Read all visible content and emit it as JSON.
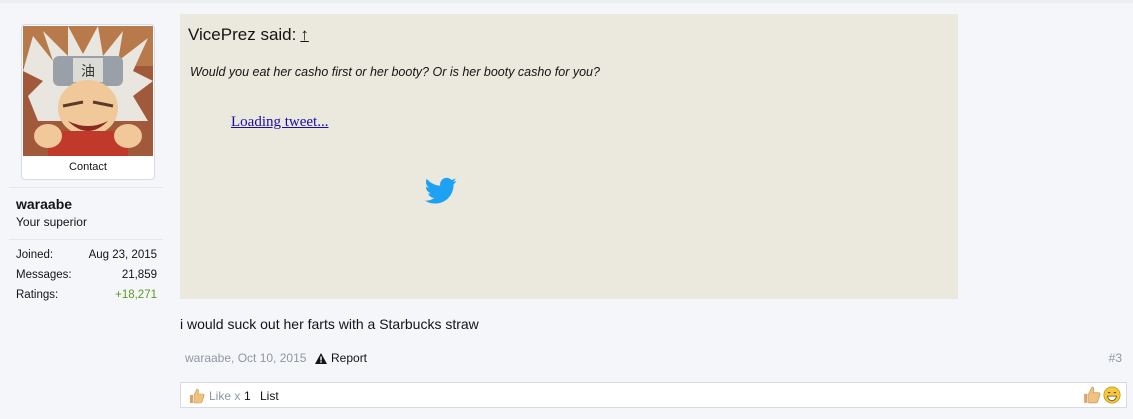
{
  "user": {
    "contact_label": "Contact",
    "name": "waraabe",
    "title": "Your superior",
    "stats": [
      {
        "label": "Joined:",
        "value": "Aug 23, 2015"
      },
      {
        "label": "Messages:",
        "value": "21,859"
      },
      {
        "label": "Ratings:",
        "value": "+18,271"
      }
    ]
  },
  "quote": {
    "author": "VicePrez said:",
    "arrow": "↑",
    "text": "Would you eat her casho first or her booty? Or is her booty casho for you?",
    "tweet_link": "Loading tweet..."
  },
  "message": {
    "body": "i would suck out her farts with a Starbucks straw"
  },
  "meta": {
    "author_date": "waraabe, Oct 10, 2015",
    "report_label": "Report",
    "post_number": "#3"
  },
  "likes": {
    "like_label": "Like x",
    "count": "1",
    "list_label": "List"
  },
  "colors": {
    "quote_bg": "#ebe8dd",
    "positive_rating": "#5a9a1e",
    "link": "#1a0dab",
    "twitter_blue": "#1da1f2"
  }
}
